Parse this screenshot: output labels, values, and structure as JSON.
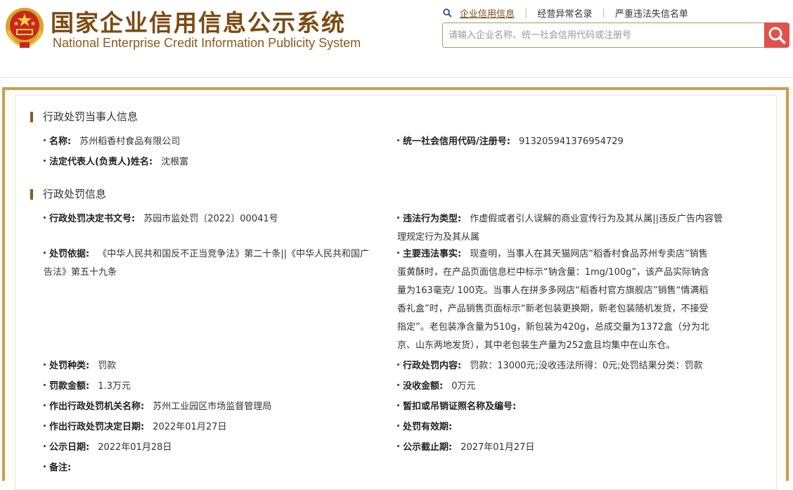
{
  "header": {
    "title_cn": "国家企业信用信息公示系统",
    "title_en": "National Enterprise Credit Information Publicity System",
    "nav": [
      "企业信用信息",
      "经营异常名录",
      "严重违法失信名单"
    ],
    "search_placeholder": "请输入企业名称、统一社会信用代码或注册号",
    "accent": "#7b4a12",
    "search_button_color": "#e0514b"
  },
  "section1": {
    "title": "行政处罚当事人信息",
    "name_label": "名称:",
    "name_value": "苏州稻香村食品有限公司",
    "credit_code_label": "统一社会信用代码/注册号:",
    "credit_code_value": "913205941376954729",
    "legal_rep_label": "法定代表人(负责人)姓名:",
    "legal_rep_value": "沈根富"
  },
  "section2": {
    "title": "行政处罚信息",
    "doc_no_label": "行政处罚决定书文号:",
    "doc_no_value": "苏园市监处罚〔2022〕00041号",
    "violation_type_label": "违法行为类型:",
    "violation_type_value_1": "作虚假或者引人误解的商业宣传行为及其从属||违反广告内容管",
    "violation_type_value_2": "理规定行为及其从属",
    "basis_label": "处罚依据:",
    "basis_value_1": "《中华人民共和国反不正当竞争法》第二十条||《中华人民共和国广",
    "basis_value_2": "告法》第五十九条",
    "facts_label": "主要违法事实:",
    "facts_lines": [
      "现查明，当事人在其天猫网店“稻香村食品苏州专卖店”销售",
      "蛋黄酥时，在产品页面信息栏中标示“钠含量：1mg/100g”，该产品实际钠含",
      "量为163毫克/ 100克。当事人在拼多多网店“稻香村官方旗舰店”销售“情满稻",
      "香礼盒”时，产品销售页面标示“新老包装更换期，新老包装随机发货，不接受",
      "指定”。老包装净含量为510g，新包装为420g，总成交量为1372盒（分为北",
      "京、山东两地发货），其中老包装生产量为252盒且均集中在山东仓。"
    ],
    "penalty_type_label": "处罚种类:",
    "penalty_type_value": "罚款",
    "penalty_content_label": "行政处罚内容:",
    "penalty_content_value": "罚款：13000元;没收违法所得：0元;处罚结果分类：罚款",
    "fine_label": "罚款金额:",
    "fine_value": "1.3万元",
    "confiscation_label": "没收金额:",
    "confiscation_value": "0万元",
    "authority_label": "作出行政处罚机关名称:",
    "authority_value": "苏州工业园区市场监督管理局",
    "license_label": "暂扣或吊销证照名称及编号:",
    "license_value": "",
    "decision_date_label": "作出行政处罚决定日期:",
    "decision_date_value": "2022年01月27日",
    "validity_label": "处罚有效期:",
    "validity_value": "",
    "publish_date_label": "公示日期:",
    "publish_date_value": "2022年01月28日",
    "publish_end_label": "公示截止期:",
    "publish_end_value": "2027年01月27日",
    "remark_label": "备注:",
    "remark_value": ""
  }
}
